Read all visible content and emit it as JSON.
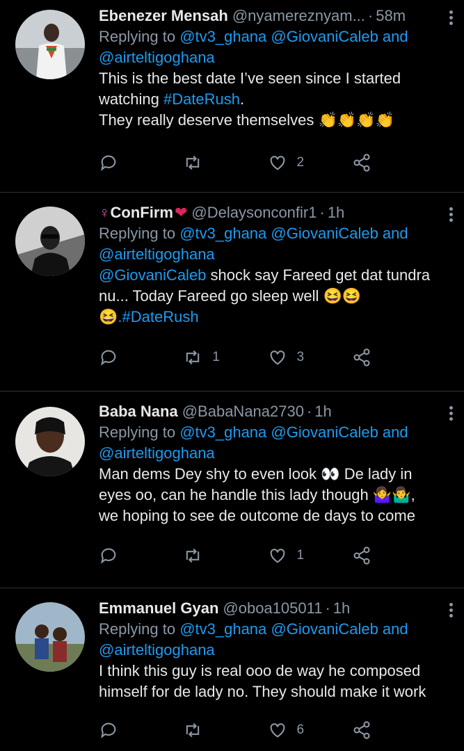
{
  "tweets": [
    {
      "name": "Ebenezer Mensah",
      "handle": "@nyamereznyam...",
      "time": "58m",
      "reply_prefix": "Replying to ",
      "reply_handles": "@tv3_ghana @GiovaniCaleb",
      "reply_and": " and",
      "reply_last": "@airteltigoghana",
      "body_line1": "This is the best date I’ve seen since I started",
      "body_line2_pre": "watching ",
      "body_hashtag": "#DateRush",
      "body_line2_post": ".",
      "body_line3": "They really deserve themselves",
      "emojis": "👏👏👏👏",
      "replies": "",
      "retweets": "",
      "likes": "2"
    },
    {
      "name": "ConFirm",
      "name_prefix_symbol": "♀",
      "name_suffix_symbol": "❤",
      "handle": "@Delaysonconfir1",
      "time": "1h",
      "reply_prefix": "Replying to ",
      "reply_handles": "@tv3_ghana @GiovaniCaleb",
      "reply_and": " and",
      "reply_last": "@airteltigoghana",
      "body_mention": "@GiovaniCaleb",
      "body_line1": " shock say Fareed get dat tundra",
      "body_line2": "nu... Today Fareed go sleep well",
      "body_emojis": "😆😆",
      "body_line3_emoji": "😆",
      "body_hashtag": ".#DateRush",
      "replies": "",
      "retweets": "1",
      "likes": "3"
    },
    {
      "name": "Baba Nana",
      "handle": "@BabaNana2730",
      "time": "1h",
      "reply_prefix": "Replying to ",
      "reply_handles": "@tv3_ghana @GiovaniCaleb",
      "reply_and": " and",
      "reply_last": "@airteltigoghana",
      "body_line1": "Man dems Dey shy to even look",
      "body_eyes": "👀",
      "body_line1_post": " De lady in",
      "body_line2": "eyes oo, can he handle this lady though",
      "body_shrug": "🤷‍♀️🤷‍♂️",
      "body_line2_post": ",",
      "body_line3": "we hoping to see de outcome de days to come",
      "replies": "",
      "retweets": "",
      "likes": "1"
    },
    {
      "name": "Emmanuel Gyan",
      "handle": "@oboa105011",
      "time": "1h",
      "reply_prefix": "Replying to ",
      "reply_handles": "@tv3_ghana @GiovaniCaleb",
      "reply_and": " and",
      "reply_last": "@airteltigoghana",
      "body_line1": "I think this guy is real ooo de way he composed",
      "body_line2": "himself for de lady no. They should make it work",
      "replies": "",
      "retweets": "",
      "likes": "6"
    }
  ],
  "colors": {
    "background": "#000000",
    "link": "#1d9bf0",
    "muted": "#8b98a5",
    "text": "#e7e9ea",
    "divider": "#2f3336"
  },
  "icons": {
    "reply": "reply-icon",
    "retweet": "retweet-icon",
    "like": "heart-icon",
    "share": "share-icon",
    "more": "more-vertical-icon"
  }
}
